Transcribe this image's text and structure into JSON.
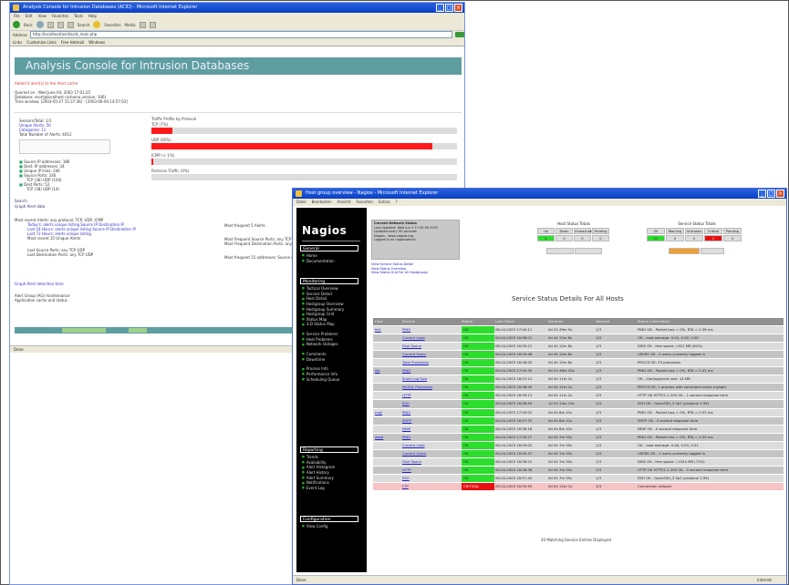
{
  "acid": {
    "title": "Analysis Console for Intrusion Databases (ACID) - Microsoft Internet Explorer",
    "menu": [
      "File",
      "Edit",
      "View",
      "Favorites",
      "Tools",
      "Help"
    ],
    "toolbar_labels": [
      "Back",
      "Search",
      "Favorites",
      "Media"
    ],
    "address": "http://localhost/acid/acid_main.php",
    "links": [
      "Links",
      "Customize Links",
      "Free Hotmail",
      "Windows"
    ],
    "banner": "Analysis Console for Intrusion Databases",
    "red_link": "Added 0 alert(s) to the Alert cache",
    "info_lines": [
      "Queried on : Wed June 04, 2003 17:01:25",
      "Database: snort@localhost (schema version: 106)",
      "Time window: [2003-05-27 15:37:36] - [2003-06-04 14:57:03]"
    ],
    "left_panel": [
      "Sensors/Total: 1/1",
      "Unique Alerts: 56",
      "Categories: 11",
      "Total Number of Alerts: 4012"
    ],
    "left_bullets": [
      "Source IP addresses: 186",
      "Dest. IP addresses: 34",
      "Unique IP links: 246",
      "Source Ports: 140",
      "TCP (36) UDP (104)",
      "Dest Ports: 52",
      "TCP (38) UDP (14)"
    ],
    "bar_labels": [
      "Traffic Profile by Protocol",
      "TCP (7%)",
      "UDP (92%)",
      "ICMP (< 1%)",
      "Portscan Traffic (0%)"
    ],
    "bar_values": [
      0,
      7,
      92,
      0.5,
      0
    ],
    "search_links": [
      "Search",
      "Graph Alert data"
    ],
    "recent_left": [
      "Most recent Alerts: any protocol, TCP, UDP, ICMP",
      "Today's: alerts unique listing Source IP Destination IP",
      "Last 24 Hours: alerts unique listing Source IP Destination IP",
      "Last 72 Hours: alerts unique listing",
      "Most recent 15 Unique Alerts",
      "Last Source Ports: any TCP UDP",
      "Last Destination Ports: any TCP UDP"
    ],
    "recent_right": [
      "Most frequent 5 Alerts",
      "Most Frequent Source Ports: any TCP UDP",
      "Most Frequent Destination Ports: any TCP UDP",
      "Most frequent 15 addresses: Source Destination"
    ],
    "lower_links": [
      "Graph Alert detection time",
      "Alert Group (AG) maintenance",
      "Application cache and status"
    ],
    "status": "Done"
  },
  "nagios": {
    "title": "Host group overview - Nagios - Microsoft Internet Explorer",
    "menu": [
      "Datei",
      "Bearbeiten",
      "Ansicht",
      "Favoriten",
      "Extras",
      "?"
    ],
    "logo": "Nagios",
    "sections": [
      "General",
      "Monitoring",
      "Reporting",
      "Configuration"
    ],
    "general": [
      "Home",
      "Documentation"
    ],
    "monitoring": [
      "Tactical Overview",
      "Service Detail",
      "Host Detail",
      "Hostgroup Overview",
      "Hostgroup Summary",
      "Hostgroup Grid",
      "Status Map",
      "3-D Status Map",
      "Service Problems",
      "Host Problems",
      "Network Outages",
      "Comments",
      "Downtime",
      "Process Info",
      "Performance Info",
      "Scheduling Queue"
    ],
    "reporting": [
      "Trends",
      "Availability",
      "Alert Histogram",
      "Alert History",
      "Alert Summary",
      "Notifications",
      "Event Log"
    ],
    "configuration": [
      "View Config"
    ],
    "host_info": [
      "Current Network Status",
      "Last Updated: Wed Jun 4 17:00:36 2003",
      "Updated every 90 seconds",
      "Nagios - www.nagios.org",
      "Logged in as nagiosadmin"
    ],
    "host_links": [
      "View Service Status Detail",
      "View Status Overview",
      "View Status Grid For All Hostgroups"
    ],
    "host_totals_title": "Host Status Totals",
    "host_totals_headers": [
      "Up",
      "Down",
      "Unreachable",
      "Pending"
    ],
    "host_totals_values": [
      "4",
      "0",
      "0",
      "0"
    ],
    "service_totals_title": "Service Status Totals",
    "service_totals_headers": [
      "Ok",
      "Warning",
      "Unknown",
      "Critical",
      "Pending"
    ],
    "service_totals_values": [
      "21",
      "0",
      "0",
      "1",
      "0"
    ],
    "page_title": "Service Status Details For All Hosts",
    "table_headers": [
      "Host",
      "Service",
      "Status",
      "Last Check",
      "Duration",
      "Attempt",
      "Status Information"
    ],
    "rows": [
      {
        "host": "fw1",
        "service": "PING",
        "status": "OK",
        "check": "06-04-2003 17:00:11",
        "duration": "0d 2h 49m 5s",
        "attempt": "1/3",
        "info": "PING OK - Packet loss = 0%, RTA = 0.36 ms"
      },
      {
        "host": "",
        "service": "Current Load",
        "status": "OK",
        "check": "06-04-2003 16:58:01",
        "duration": "0d 4h 12m 8s",
        "attempt": "1/3",
        "info": "OK - load average: 0.00, 0.00, 0.00"
      },
      {
        "host": "",
        "service": "Disk Space",
        "status": "OK",
        "check": "06-04-2003 16:55:21",
        "duration": "0d 4h 12m 8s",
        "attempt": "1/3",
        "info": "DISK OK - free space: / 612 MB (64%)"
      },
      {
        "host": "",
        "service": "Current Users",
        "status": "OK",
        "check": "06-04-2003 16:59:48",
        "duration": "0d 4h 12m 8s",
        "attempt": "1/3",
        "info": "USERS OK - 0 users currently logged in"
      },
      {
        "host": "",
        "service": "Total Processes",
        "status": "OK",
        "check": "06-04-2003 16:56:05",
        "duration": "0d 4h 12m 8s",
        "attempt": "1/3",
        "info": "PROCS OK: 33 processes"
      },
      {
        "host": "ids",
        "service": "PING",
        "status": "OK",
        "check": "06-04-2003 17:00:35",
        "duration": "0d 2h 48m 30s",
        "attempt": "1/3",
        "info": "PING OK - Packet loss = 0%, RTA = 0.41 ms"
      },
      {
        "host": "",
        "service": "Snort Log Size",
        "status": "OK",
        "check": "06-04-2003 16:57:12",
        "duration": "0d 4h 11m 2s",
        "attempt": "1/3",
        "info": "OK - /var/log/snort size: 14 MB"
      },
      {
        "host": "",
        "service": "MySQL Processes",
        "status": "OK",
        "check": "06-04-2003 16:58:40",
        "duration": "0d 4h 11m 2s",
        "attempt": "1/3",
        "info": "PROCS OK: 1 process with command name mysqld"
      },
      {
        "host": "",
        "service": "HTTP",
        "status": "OK",
        "check": "06-04-2003 16:59:13",
        "duration": "0d 4h 11m 2s",
        "attempt": "1/3",
        "info": "HTTP OK HTTP/1.1 200 OK - 1 second response time"
      },
      {
        "host": "",
        "service": "SSH",
        "status": "OK",
        "check": "06-04-2003 16:56:59",
        "duration": "1d 2h 14m 15s",
        "attempt": "1/3",
        "info": "SSH OK - OpenSSH_3.5p1 (protocol 1.99)"
      },
      {
        "host": "mail",
        "service": "PING",
        "status": "OK",
        "check": "06-04-2003 17:00:02",
        "duration": "0d 4h 8m 41s",
        "attempt": "1/3",
        "info": "PING OK - Packet loss = 0%, RTA = 0.52 ms"
      },
      {
        "host": "",
        "service": "SMTP",
        "status": "OK",
        "check": "06-04-2003 16:57:33",
        "duration": "0d 4h 8m 41s",
        "attempt": "1/3",
        "info": "SMTP OK - 0 second response time"
      },
      {
        "host": "",
        "service": "IMAP",
        "status": "OK",
        "check": "06-04-2003 16:58:18",
        "duration": "0d 4h 8m 41s",
        "attempt": "1/3",
        "info": "IMAP OK - 0 second response time"
      },
      {
        "host": "www",
        "service": "PING",
        "status": "OK",
        "check": "06-04-2003 17:00:27",
        "duration": "0d 4h 7m 55s",
        "attempt": "1/3",
        "info": "PING OK - Packet loss = 0%, RTA = 0.30 ms"
      },
      {
        "host": "",
        "service": "Current Load",
        "status": "OK",
        "check": "06-04-2003 16:59:02",
        "duration": "0d 4h 7m 55s",
        "attempt": "1/3",
        "info": "OK - load average: 0.08, 0.03, 0.01"
      },
      {
        "host": "",
        "service": "Current Users",
        "status": "OK",
        "check": "06-04-2003 16:55:47",
        "duration": "0d 4h 7m 55s",
        "attempt": "1/3",
        "info": "USERS OK - 1 users currently logged in"
      },
      {
        "host": "",
        "service": "Disk Space",
        "status": "OK",
        "check": "06-04-2003 16:56:22",
        "duration": "0d 4h 7m 55s",
        "attempt": "1/3",
        "info": "DISK OK - free space: / 1544 MB (71%)"
      },
      {
        "host": "",
        "service": "HTTP",
        "status": "OK",
        "check": "06-04-2003 16:58:36",
        "duration": "0d 4h 7m 55s",
        "attempt": "1/3",
        "info": "HTTP OK HTTP/1.1 200 OK - 0 second response time"
      },
      {
        "host": "",
        "service": "SSH",
        "status": "OK",
        "check": "06-04-2003 16:57:44",
        "duration": "0d 4h 7m 55s",
        "attempt": "1/3",
        "info": "SSH OK - OpenSSH_3.5p1 (protocol 1.99)"
      },
      {
        "host": "",
        "service": "FTP",
        "status": "CRITICAL",
        "check": "06-04-2003 16:59:55",
        "duration": "0d 0h 12m 1s",
        "attempt": "3/3",
        "info": "Connection refused"
      }
    ],
    "footnote": "20 Matching Service Entries Displayed",
    "status_left": "Done",
    "status_right": "Internet",
    "colors": {
      "ok": "#2ddd2d",
      "critical": "#e81010",
      "header": "#909090"
    }
  }
}
